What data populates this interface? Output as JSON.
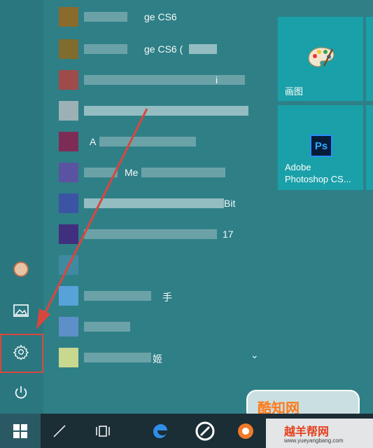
{
  "apps": [
    {
      "label": "ge CS6",
      "icon_color": "#8b6b2b"
    },
    {
      "label": "ge CS6 (",
      "icon_color": "#7f6c2f"
    },
    {
      "label": "i",
      "icon_color": "#a04b4b"
    },
    {
      "label": "",
      "icon_color": "#9bb1b5"
    },
    {
      "label": "A",
      "icon_color": "#7d2c55"
    },
    {
      "label": "Me",
      "icon_color": "#5a53a2"
    },
    {
      "label": "Bit",
      "icon_color": "#3b55a4"
    },
    {
      "label": "17",
      "icon_color": "#402f7e"
    },
    {
      "label": "",
      "icon_color": "#3f8aa0"
    },
    {
      "label": "手",
      "icon_color": "#57a2d8"
    },
    {
      "label": "",
      "icon_color": "#5f8fc8"
    },
    {
      "label": "姬",
      "icon_color": "#c8d88f"
    }
  ],
  "tiles": {
    "paint": {
      "label": "画图"
    },
    "photoshop": {
      "label_line1": "Adobe",
      "label_line2": "Photoshop CS...",
      "icon_text": "Ps"
    }
  },
  "rail": {
    "icons": [
      "user-avatar-icon",
      "pictures-icon",
      "settings-icon",
      "power-icon"
    ]
  },
  "taskbar": {
    "icons": [
      "start-windows-icon",
      "task-view-icon",
      "edge-icon",
      "browser-icon"
    ]
  },
  "watermarks": {
    "top": "酷知网",
    "bottom": "越羊帮网",
    "bottom_url": "www.yueyangbang.com"
  }
}
